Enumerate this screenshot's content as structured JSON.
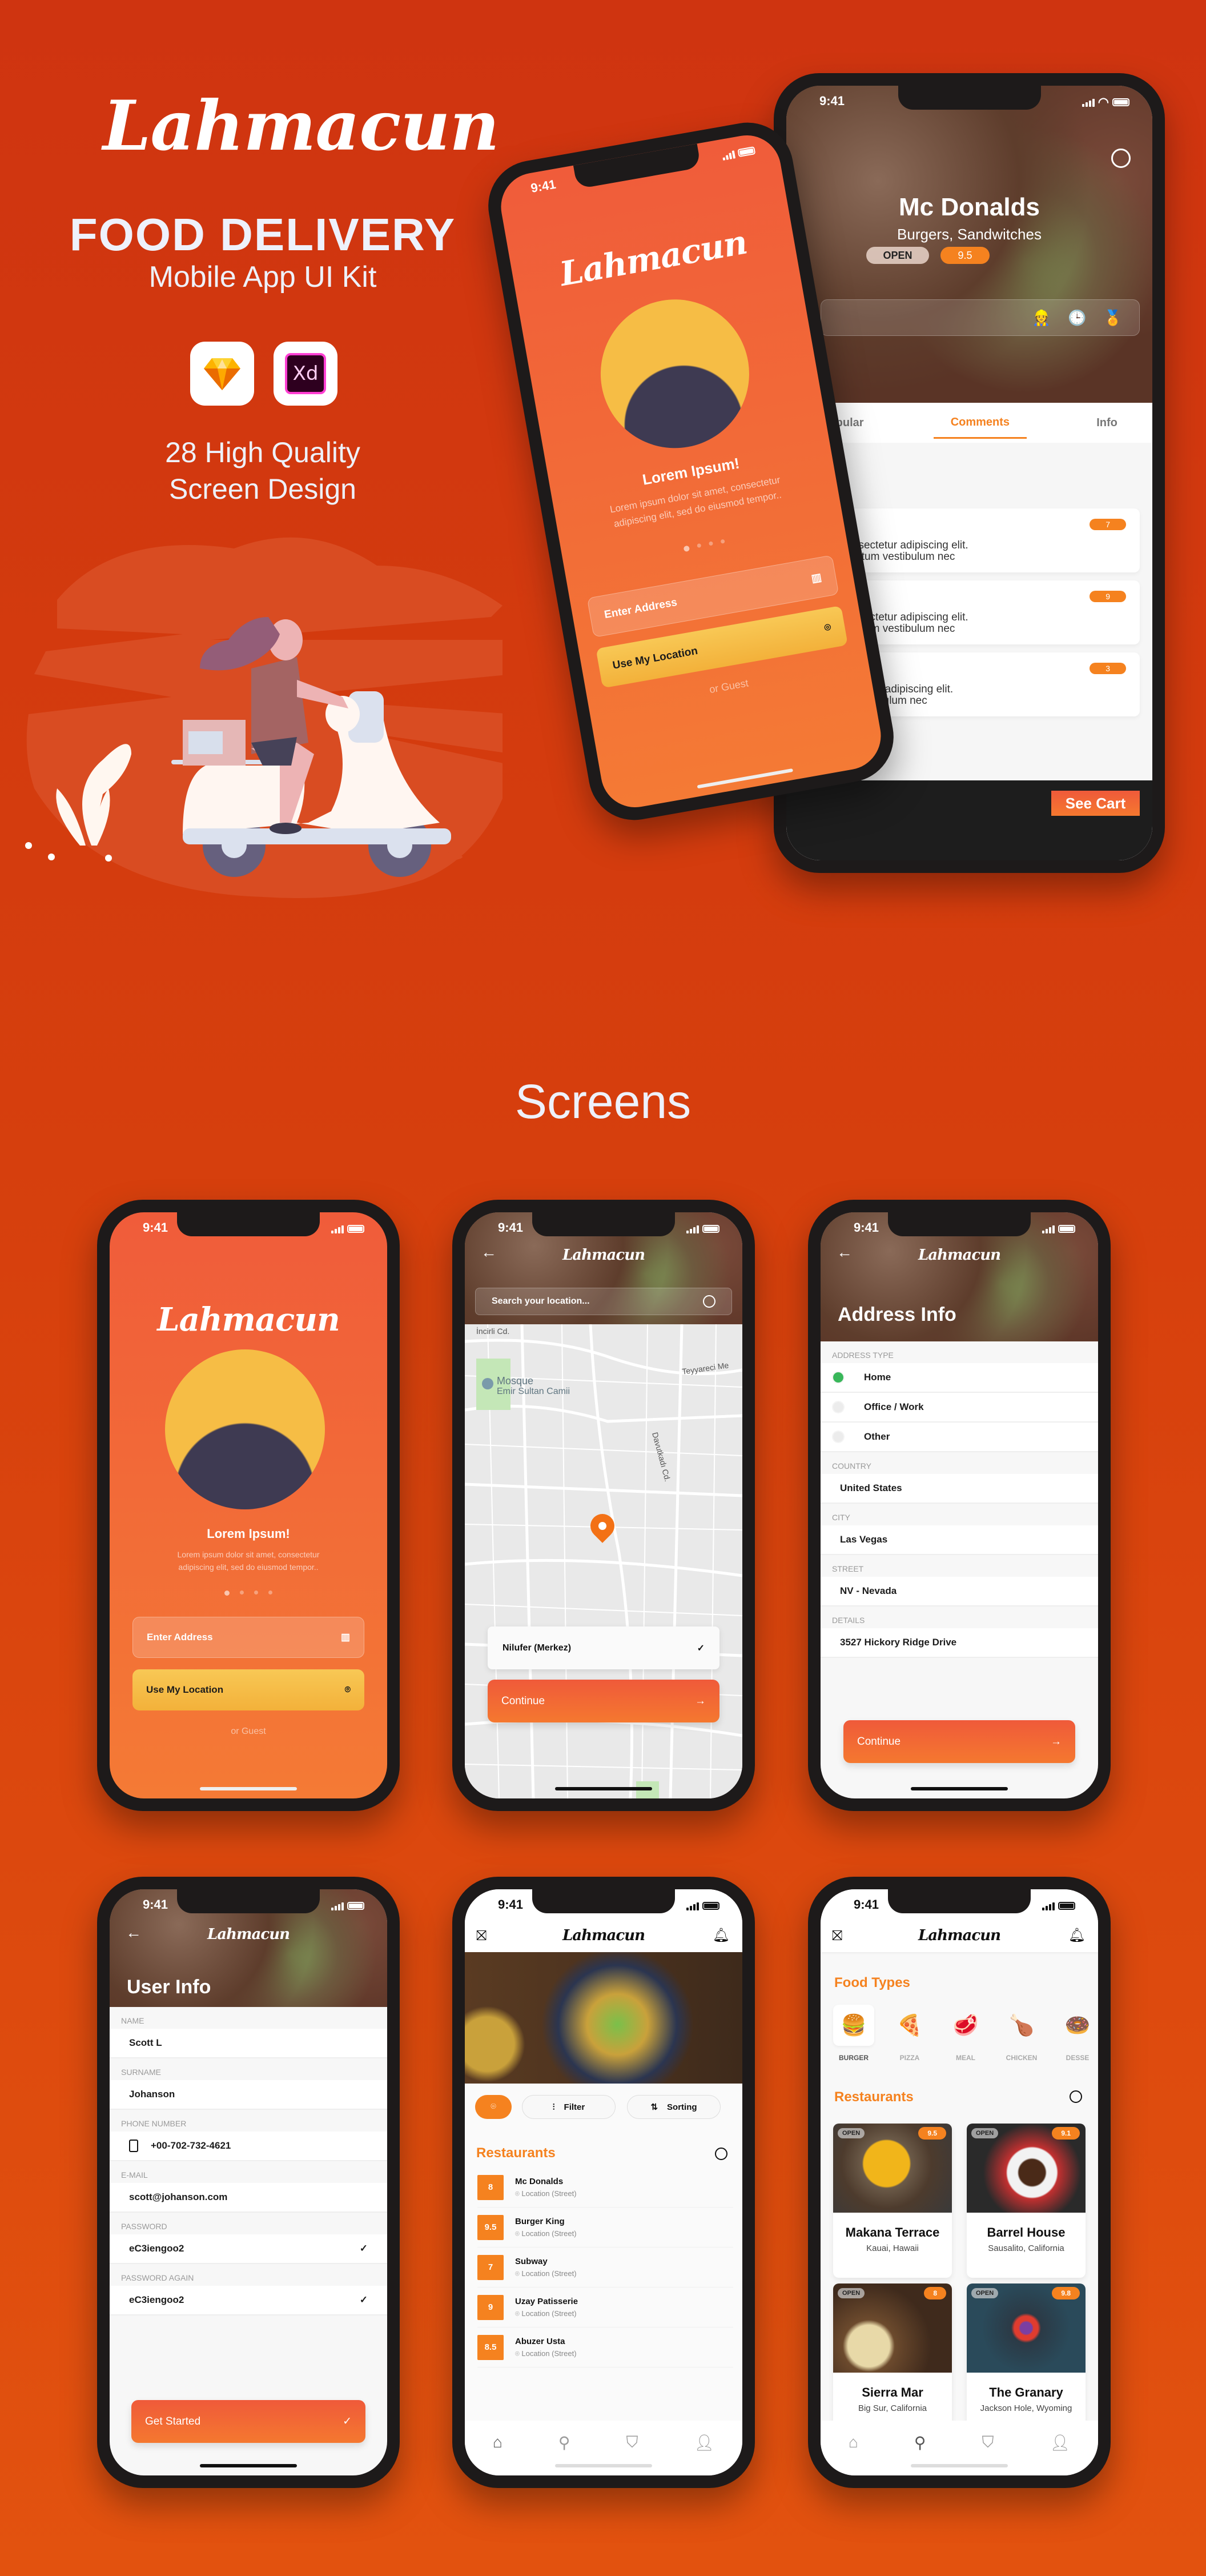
{
  "hero": {
    "brand": "Lahmacun",
    "title": "FOOD DELIVERY",
    "subtitle": "Mobile App UI Kit",
    "tool_icons": [
      "sketch-icon",
      "xd-icon"
    ],
    "xd_label": "Xd",
    "quality_line1": "28 High Quality",
    "quality_line2": "Screen Design"
  },
  "colors": {
    "background": "#d63f0d",
    "accent_orange": "#f5821f",
    "button_gradient_start": "#ef5a3a",
    "button_gradient_end": "#f5782f",
    "yellow": "#f6bd45",
    "open_green": "#39b75a"
  },
  "status_bar": {
    "time": "9:41"
  },
  "featured_restaurant": {
    "name": "Mc Donalds",
    "category": "Burgers, Sandwitches",
    "status": "OPEN",
    "rating": "9.5",
    "badges": [
      "courier-icon",
      "24-hours-icon",
      "award-icon"
    ],
    "tabs": [
      {
        "label": "Popular",
        "active": false
      },
      {
        "label": "Comments",
        "active": true
      },
      {
        "label": "Info",
        "active": false
      }
    ],
    "comments": [
      {
        "score": "7",
        "line1": "t, consectetur adipiscing elit.",
        "line2": "dimentum vestibulum nec"
      },
      {
        "score": "9",
        "line1": "t, consectetur adipiscing elit.",
        "line2": "dimentum vestibulum nec"
      },
      {
        "score": "3",
        "line1": "ctetur adipiscing elit.",
        "line2": "vestibulum nec"
      }
    ],
    "see_cart": "See Cart"
  },
  "onboarding": {
    "brand": "Lahmacun",
    "heading": "Lorem Ipsum!",
    "body_line1": "Lorem ipsum dolor sit amet, consectetur",
    "body_line2": "adipiscing elit, sed do eiusmod tempor..",
    "page_count": 4,
    "active_page": 1,
    "address_placeholder": "Enter Address",
    "use_location": "Use My Location",
    "guest": "or Guest"
  },
  "section_title": "Screens",
  "map_screen": {
    "brand": "Lahmacun",
    "search_placeholder": "Search your location...",
    "labels": {
      "street1": "İncirli Cd.",
      "street2": "Teyyareci Me",
      "street3": "Davutkadı Cd.",
      "poi_type": "Mosque",
      "poi_name": "Emir Sultan Camii"
    },
    "selected_location": "Nilufer (Merkez)",
    "continue": "Continue"
  },
  "address_screen": {
    "brand": "Lahmacun",
    "title": "Address Info",
    "address_type_label": "ADDRESS TYPE",
    "types": [
      {
        "label": "Home",
        "selected": true
      },
      {
        "label": "Office / Work",
        "selected": false
      },
      {
        "label": "Other",
        "selected": false
      }
    ],
    "fields": [
      {
        "label": "COUNTRY",
        "value": "United States"
      },
      {
        "label": "CITY",
        "value": "Las Vegas"
      },
      {
        "label": "STREET",
        "value": "NV - Nevada"
      },
      {
        "label": "DETAILS",
        "value": "3527  Hickory Ridge Drive"
      }
    ],
    "continue": "Continue"
  },
  "user_screen": {
    "brand": "Lahmacun",
    "title": "User Info",
    "fields": [
      {
        "label": "NAME",
        "value": "Scott L"
      },
      {
        "label": "SURNAME",
        "value": "Johanson"
      },
      {
        "label": "PHONE NUMBER",
        "value": "+00-702-732-4621"
      },
      {
        "label": "E-MAIL",
        "value": "scott@johanson.com"
      },
      {
        "label": "PASSWORD",
        "value": "eC3iengoo2"
      },
      {
        "label": "PASSWORD AGAIN",
        "value": "eC3iengoo2"
      }
    ],
    "get_started": "Get Started"
  },
  "list_screen": {
    "brand": "Lahmacun",
    "filter": "Filter",
    "sorting": "Sorting",
    "section": "Restaurants",
    "restaurants": [
      {
        "score": "8",
        "name": "Mc Donalds",
        "location": "Location (Street)"
      },
      {
        "score": "9.5",
        "name": "Burger King",
        "location": "Location (Street)"
      },
      {
        "score": "7",
        "name": "Subway",
        "location": "Location (Street)"
      },
      {
        "score": "9",
        "name": "Uzay Patisserie",
        "location": "Location (Street)"
      },
      {
        "score": "8.5",
        "name": "Abuzer Usta",
        "location": "Location (Street)"
      }
    ]
  },
  "grid_screen": {
    "brand": "Lahmacun",
    "food_types_title": "Food Types",
    "food_types": [
      {
        "label": "BURGER",
        "icon": "🍔",
        "active": true
      },
      {
        "label": "PIZZA",
        "icon": "🍕",
        "active": false
      },
      {
        "label": "MEAL",
        "icon": "🥩",
        "active": false
      },
      {
        "label": "CHICKEN",
        "icon": "🍗",
        "active": false
      },
      {
        "label": "DESSE",
        "icon": "🍩",
        "active": false
      }
    ],
    "restaurants_title": "Restaurants",
    "cards": [
      {
        "name": "Makana Terrace",
        "location": "Kauai, Hawaii",
        "status": "OPEN",
        "rating": "9.5"
      },
      {
        "name": "Barrel House",
        "location": "Sausalito, California",
        "status": "OPEN",
        "rating": "9.1"
      },
      {
        "name": "Sierra Mar",
        "location": "Big Sur, California",
        "status": "OPEN",
        "rating": "8"
      },
      {
        "name": "The Granary",
        "location": "Jackson Hole, Wyoming",
        "status": "OPEN",
        "rating": "9.8"
      }
    ]
  }
}
